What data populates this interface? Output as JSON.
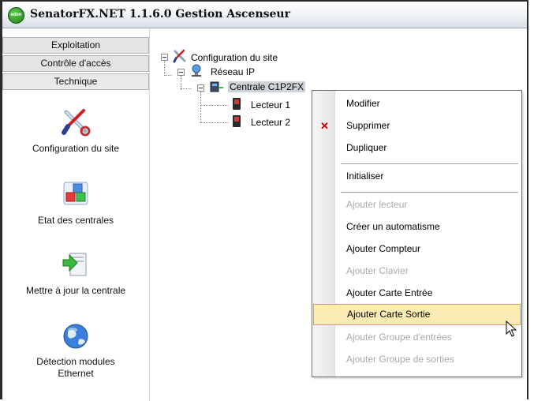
{
  "window": {
    "title": "SenatorFX.NET 1.1.6.0 Gestion Ascenseur",
    "logo_text": "eden"
  },
  "sidebar": {
    "nav": [
      "Exploitation",
      "Contrôle d'accès",
      "Technique"
    ],
    "items": [
      {
        "label": "Configuration du site",
        "icon": "tools-icon"
      },
      {
        "label": "Etat des centrales",
        "icon": "cubes-icon"
      },
      {
        "label": "Mettre à jour la centrale",
        "icon": "update-icon"
      },
      {
        "label_line1": "Détection modules",
        "label_line2": "Ethernet",
        "icon": "globe-icon"
      }
    ]
  },
  "tree": {
    "root": "Configuration du site",
    "network": "Réseau IP",
    "central": "Centrale C1P2FX",
    "readers": [
      "Lecteur 1",
      "Lecteur 2"
    ]
  },
  "context_menu": {
    "items": [
      {
        "label": "Modifier",
        "enabled": true
      },
      {
        "label": "Supprimer",
        "enabled": true,
        "icon": "delete-x-icon"
      },
      {
        "label": "Dupliquer",
        "enabled": true
      },
      {
        "label": "Initialiser",
        "enabled": true
      },
      {
        "label": "Ajouter lecteur",
        "enabled": false
      },
      {
        "label": "Créer un automatisme",
        "enabled": true
      },
      {
        "label": "Ajouter Compteur",
        "enabled": true
      },
      {
        "label": "Ajouter Clavier",
        "enabled": false
      },
      {
        "label": "Ajouter Carte Entrée",
        "enabled": true
      },
      {
        "label": "Ajouter Carte Sortie",
        "enabled": true,
        "highlighted": true
      },
      {
        "label": "Ajouter Groupe d'entrées",
        "enabled": false
      },
      {
        "label": "Ajouter Groupe de sorties",
        "enabled": false
      }
    ]
  },
  "colors": {
    "menu_highlight": "#fdebb6",
    "menu_highlight_border": "#d3a63c",
    "disabled_text": "#a9a9a9",
    "delete_icon": "#c00000"
  }
}
